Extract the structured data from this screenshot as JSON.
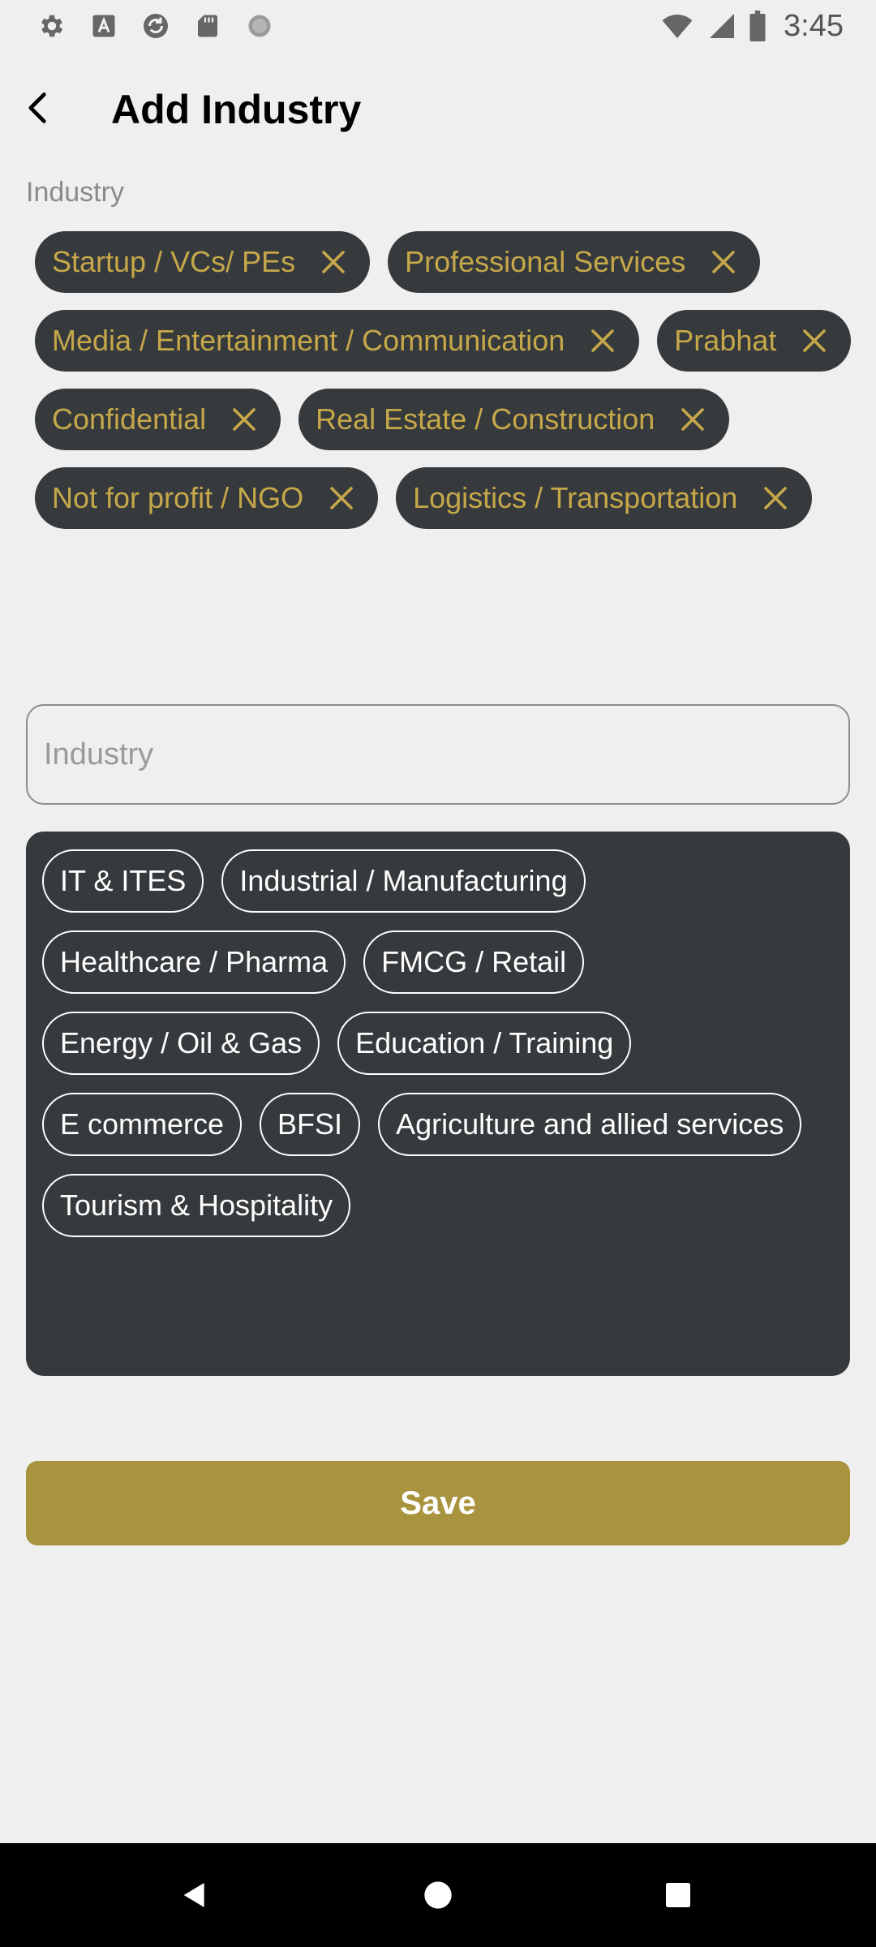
{
  "status_bar": {
    "time": "3:45",
    "left_icons": [
      "settings-icon",
      "font-a-icon",
      "sync-icon",
      "sd-card-icon",
      "circle-loading-icon"
    ],
    "right_icons": [
      "wifi-icon",
      "signal-icon",
      "battery-icon"
    ]
  },
  "header": {
    "title": "Add Industry",
    "back_icon": "back-arrow-icon"
  },
  "industry": {
    "label": "Industry",
    "input_placeholder": "Industry",
    "input_value": "",
    "selected": [
      "Startup / VCs/ PEs",
      "Professional Services",
      "Media / Entertainment / Communication",
      "Prabhat",
      "Confidential",
      "Real Estate / Construction",
      "Not for profit / NGO",
      "Logistics / Transportation"
    ],
    "options": [
      "IT & ITES",
      "Industrial / Manufacturing",
      "Healthcare / Pharma",
      "FMCG / Retail",
      "Energy / Oil & Gas",
      "Education / Training",
      "E commerce",
      "BFSI",
      "Agriculture and allied services",
      "Tourism & Hospitality"
    ]
  },
  "actions": {
    "save_label": "Save"
  },
  "nav_bar": {
    "icons": [
      "nav-back-icon",
      "nav-home-icon",
      "nav-recents-icon"
    ]
  },
  "colors": {
    "background": "#efefef",
    "chip_dark": "#363a3c",
    "chip_text_gold": "#c6a84a",
    "save_button": "#a8933e",
    "nav_bar": "#000000"
  }
}
